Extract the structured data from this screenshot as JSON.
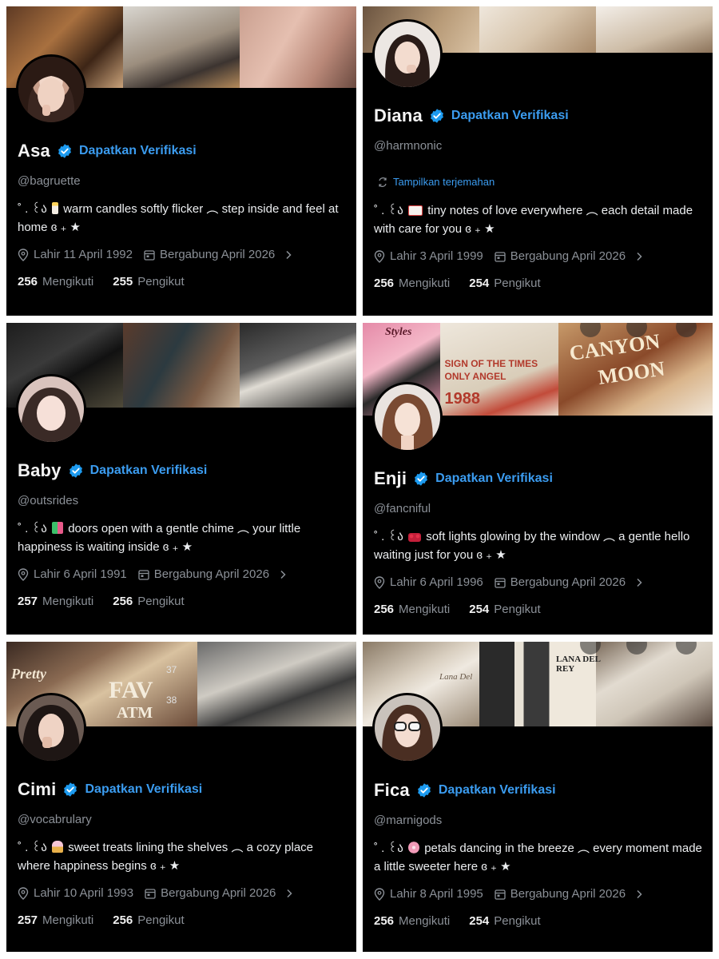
{
  "cards": [
    {
      "name": "Asa",
      "verify_label": "Dapatkan Verifikasi",
      "handle": "@bagruette",
      "bio_prefix": "˚ . ꒰ა",
      "bio_emoji": "candle",
      "bio_line1": "warm candles softly flicker ︵ step inside and feel at",
      "bio_line2": "home ɞ ₊ ★",
      "birth": "Lahir 11 April 1992",
      "joined": "Bergabung April 2026",
      "following_count": "256",
      "following_label": "Mengikuti",
      "followers_count": "255",
      "followers_label": "Pengikut"
    },
    {
      "name": "Diana",
      "verify_label": "Dapatkan Verifikasi",
      "handle": "@harmnonic",
      "translate_label": "Tampilkan terjemahan",
      "bio_prefix": "˚ . ꒰ა",
      "bio_emoji": "love-letter",
      "bio_line1": "tiny notes of love everywhere ︵ each detail made",
      "bio_line2": "with care for you ɞ ₊ ★",
      "birth": "Lahir 3 April 1999",
      "joined": "Bergabung April 2026",
      "following_count": "256",
      "following_label": "Mengikuti",
      "followers_count": "254",
      "followers_label": "Pengikut"
    },
    {
      "name": "Baby",
      "verify_label": "Dapatkan Verifikasi",
      "handle": "@outsrides",
      "bio_prefix": "˚ . ꒰ა",
      "bio_emoji": "shopping-bags",
      "bio_line1": "doors open with a gentle chime ︵ your little",
      "bio_line2": "happiness is waiting inside ɞ ₊ ★",
      "birth": "Lahir 6 April 1991",
      "joined": "Bergabung April 2026",
      "following_count": "257",
      "following_label": "Mengikuti",
      "followers_count": "256",
      "followers_label": "Pengikut"
    },
    {
      "name": "Enji",
      "verify_label": "Dapatkan Verifikasi",
      "handle": "@fancniful",
      "bio_prefix": "˚ . ꒰ა",
      "bio_emoji": "ribbon",
      "bio_line1": "soft lights glowing by the window ︵ a gentle hello",
      "bio_line2": "waiting just for you ɞ ₊ ★",
      "birth": "Lahir 6 April 1996",
      "joined": "Bergabung April 2026",
      "following_count": "256",
      "following_label": "Mengikuti",
      "followers_count": "254",
      "followers_label": "Pengikut"
    },
    {
      "name": "Cimi",
      "verify_label": "Dapatkan Verifikasi",
      "handle": "@vocabrulary",
      "bio_prefix": "˚ . ꒰ა",
      "bio_emoji": "cupcake",
      "bio_line1": "sweet treats lining the shelves ︵ a cozy place",
      "bio_line2": "where happiness begins ɞ ₊ ★",
      "birth": "Lahir 10 April 1993",
      "joined": "Bergabung April 2026",
      "following_count": "257",
      "following_label": "Mengikuti",
      "followers_count": "256",
      "followers_label": "Pengikut"
    },
    {
      "name": "Fica",
      "verify_label": "Dapatkan Verifikasi",
      "handle": "@marnigods",
      "bio_prefix": "˚ . ꒰ა",
      "bio_emoji": "cherry-blossom",
      "bio_line1": "petals dancing in the breeze ︵ every moment made",
      "bio_line2": "a little sweeter here ɞ ₊ ★",
      "birth": "Lahir 8 April 1995",
      "joined": "Bergabung April 2026",
      "following_count": "256",
      "following_label": "Mengikuti",
      "followers_count": "254",
      "followers_label": "Pengikut"
    }
  ],
  "banner_text": {
    "enji_1": "Styles",
    "enji_2": "SIGN OF THE TIMES",
    "enji_3": "ONLY ANGEL",
    "enji_4": "1988",
    "enji_5": "CANYON",
    "enji_6": "MOON",
    "cimi_1": "Pretty",
    "cimi_2": "FAV",
    "cimi_3": "ATM",
    "cimi_4": "37",
    "cimi_5": "38",
    "fica_1": "Lana Del",
    "fica_2": "LANA DEL REY"
  },
  "colors": {
    "card_bg": "#000000",
    "accent_blue": "#3b9cf0",
    "muted": "#8b9097",
    "verified_badge": "#1d9bf0"
  }
}
